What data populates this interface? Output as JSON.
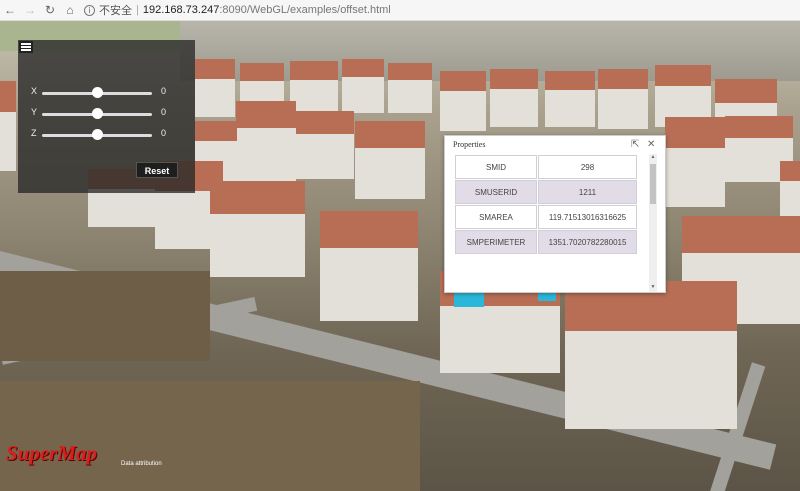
{
  "browser": {
    "back_icon": "back-arrow-icon",
    "forward_icon": "forward-arrow-icon",
    "reload_icon": "reload-icon",
    "home_icon": "home-icon",
    "security_label": "不安全",
    "separator": "|",
    "url_host": "192.168.73.247",
    "url_rest": ":8090/WebGL/examples/offset.html"
  },
  "controls": {
    "menu_icon": "hamburger-menu-icon",
    "sliders": [
      {
        "label": "X",
        "value": "0",
        "fraction": 0.5
      },
      {
        "label": "Y",
        "value": "0",
        "fraction": 0.5
      },
      {
        "label": "Z",
        "value": "0",
        "fraction": 0.5
      }
    ],
    "reset_label": "Reset"
  },
  "popup": {
    "title": "Properties",
    "expand_icon": "external-link-icon",
    "close_icon": "close-icon",
    "rows": [
      {
        "field": "SMID",
        "value": "298"
      },
      {
        "field": "SMUSERID",
        "value": "1211"
      },
      {
        "field": "SMAREA",
        "value": "119.71513016316625"
      },
      {
        "field": "SMPERIMETER",
        "value": "1351.7020782280015"
      }
    ]
  },
  "footer": {
    "logo_text": "SuperMap",
    "attribution": "Data attribution"
  },
  "colors": {
    "roof": "#b76e55",
    "wall": "#e3e0da",
    "highlight": "#2bb7d9",
    "alt_row": "#e2dce8",
    "logo": "#d7201b"
  }
}
